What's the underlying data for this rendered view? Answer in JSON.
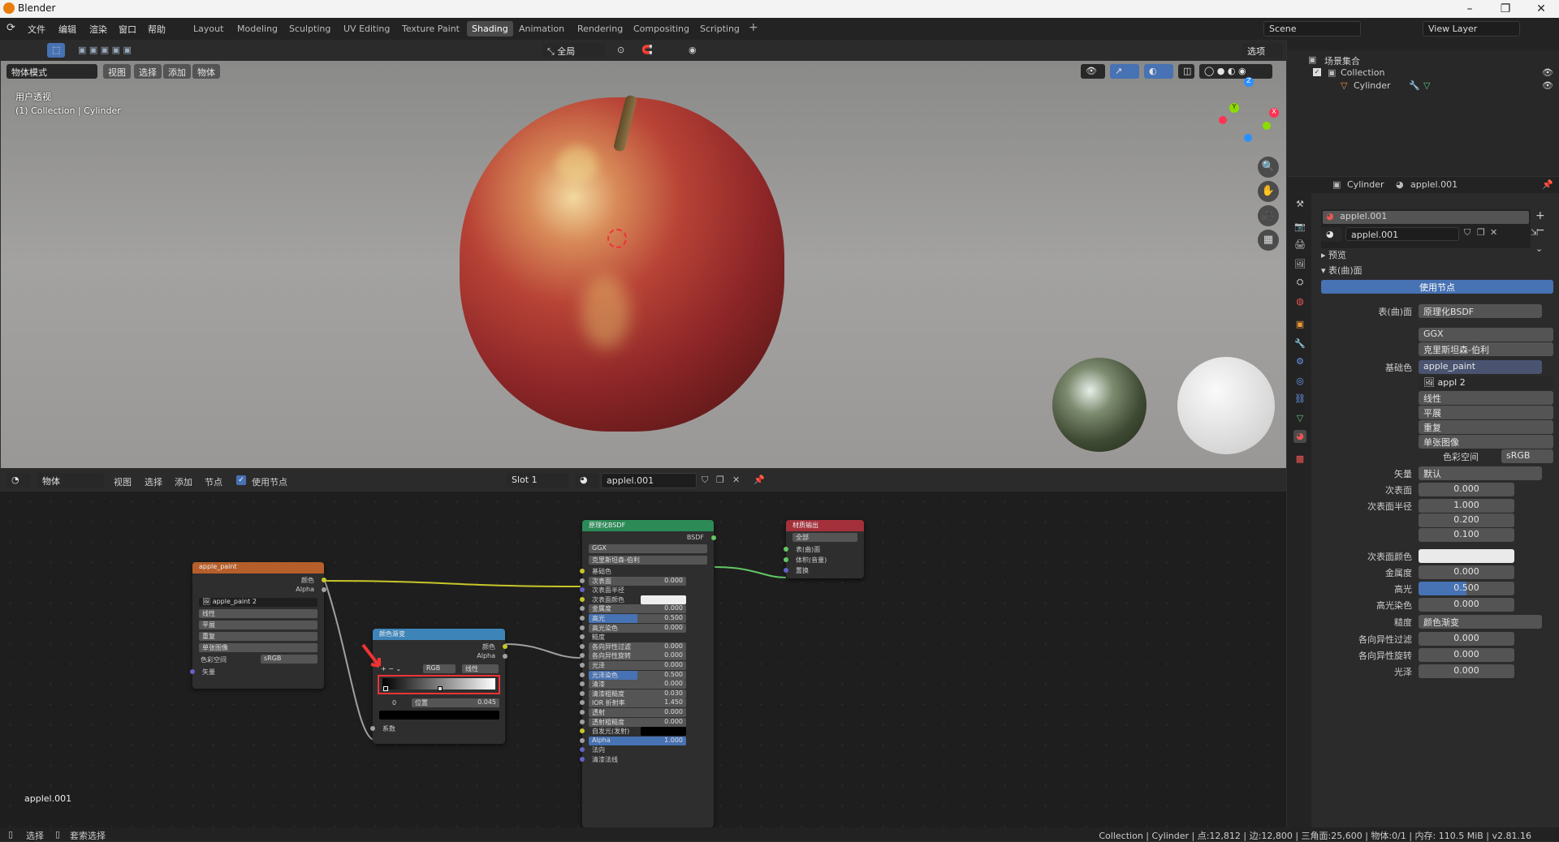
{
  "app": {
    "title": "Blender"
  },
  "menu": [
    "文件",
    "编辑",
    "渲染",
    "窗口",
    "帮助"
  ],
  "workspaces": [
    "Layout",
    "Modeling",
    "Sculpting",
    "UV Editing",
    "Texture Paint",
    "Shading",
    "Animation",
    "Rendering",
    "Compositing",
    "Scripting"
  ],
  "active_workspace": "Shading",
  "scene": "Scene",
  "view_layer": "View Layer",
  "viewport": {
    "transform_space": "全局",
    "options": "选项",
    "mode": "物体模式",
    "menus": [
      "视图",
      "选择",
      "添加",
      "物体"
    ],
    "info_line1": "用户透视",
    "info_line2": "(1) Collection | Cylinder"
  },
  "node_editor": {
    "type": "物体",
    "menus": [
      "视图",
      "选择",
      "添加",
      "节点"
    ],
    "use_nodes_label": "使用节点",
    "slot": "Slot 1",
    "material": "applel.001",
    "footer_material": "applel.001"
  },
  "nodes": {
    "image": {
      "title": "apple_paint",
      "out_color": "颜色",
      "out_alpha": "Alpha",
      "image_name": "apple_paint",
      "users": "2",
      "interp": "线性",
      "proj": "平展",
      "ext": "重复",
      "src": "单张图像",
      "cs_label": "色彩空间",
      "cs_value": "sRGB",
      "vec": "矢量"
    },
    "ramp": {
      "title": "颜色渐变",
      "out_color": "颜色",
      "out_alpha": "Alpha",
      "mode": "RGB",
      "interp": "线性",
      "index": "0",
      "pos_label": "位置",
      "pos_value": "0.045",
      "fac": "系数"
    },
    "bsdf": {
      "title": "原理化BSDF",
      "out": "BSDF",
      "dist": "GGX",
      "sss": "克里斯坦森-伯利",
      "rows": [
        {
          "label": "基础色",
          "value": ""
        },
        {
          "label": "次表面",
          "value": "0.000"
        },
        {
          "label": "次表面半径",
          "value": ""
        },
        {
          "label": "次表面颜色",
          "value": ""
        },
        {
          "label": "金属度",
          "value": "0.000"
        },
        {
          "label": "高光",
          "value": "0.500"
        },
        {
          "label": "高光染色",
          "value": "0.000"
        },
        {
          "label": "糙度",
          "value": ""
        },
        {
          "label": "各向异性过滤",
          "value": "0.000"
        },
        {
          "label": "各向异性旋转",
          "value": "0.000"
        },
        {
          "label": "光泽",
          "value": "0.000"
        },
        {
          "label": "光泽染色",
          "value": "0.500"
        },
        {
          "label": "清漆",
          "value": "0.000"
        },
        {
          "label": "清漆粗糙度",
          "value": "0.030"
        },
        {
          "label": "IOR 折射率",
          "value": "1.450"
        },
        {
          "label": "透射",
          "value": "0.000"
        },
        {
          "label": "透射粗糙度",
          "value": "0.000"
        },
        {
          "label": "自发光(发射)",
          "value": ""
        },
        {
          "label": "Alpha",
          "value": "1.000"
        },
        {
          "label": "法向",
          "value": ""
        },
        {
          "label": "清漆法线",
          "value": ""
        }
      ]
    },
    "output": {
      "title": "材质输出",
      "target": "全部",
      "surface": "表(曲)面",
      "volume": "体积(音量)",
      "disp": "置换"
    }
  },
  "outliner": {
    "root": "场景集合",
    "collection": "Collection",
    "object": "Cylinder"
  },
  "properties": {
    "object": "Cylinder",
    "material": "applel.001",
    "slot_name": "applel.001",
    "mat_field": "applel.001",
    "preview": "预览",
    "surface_panel": "表(曲)面",
    "use_nodes": "使用节点",
    "surface_label": "表(曲)面",
    "surface_value": "原理化BSDF",
    "dist": "GGX",
    "sss_method": "克里斯坦森-伯利",
    "base_label": "基础色",
    "base_value": "apple_paint",
    "img_short": "appl",
    "img_users": "2",
    "interp": "线性",
    "proj": "平展",
    "ext": "重复",
    "src": "单张图像",
    "cs_label": "色彩空间",
    "cs_value": "sRGB",
    "vec_label": "矢量",
    "vec_value": "默认",
    "sub_label": "次表面",
    "sub_value": "0.000",
    "subr_label": "次表面半径",
    "subr_values": [
      "1.000",
      "0.200",
      "0.100"
    ],
    "subc_label": "次表面颜色",
    "metal_label": "金属度",
    "metal_value": "0.000",
    "spec_label": "高光",
    "spec_value": "0.500",
    "spect_label": "高光染色",
    "spect_value": "0.000",
    "rough_label": "糙度",
    "rough_value": "颜色渐变",
    "aniso_label": "各向异性过滤",
    "aniso_value": "0.000",
    "anisor_label": "各向异性旋转",
    "anisor_value": "0.000",
    "sheen_label": "光泽",
    "sheen_value": "0.000"
  },
  "statusbar": {
    "select": "选择",
    "box_select": "套索选择",
    "info": "Collection | Cylinder | 点:12,812 | 边:12,800 | 三角面:25,600 | 物体:0/1 | 内存: 110.5 MiB | v2.81.16"
  }
}
